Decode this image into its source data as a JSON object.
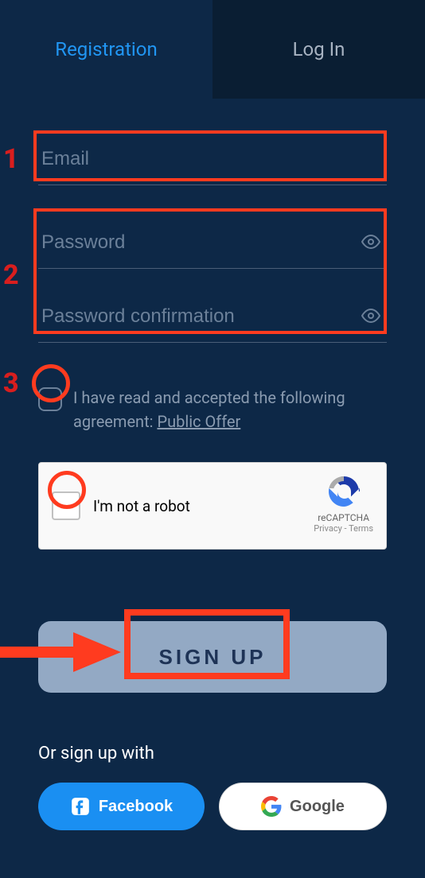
{
  "tabs": {
    "registration": "Registration",
    "login": "Log In"
  },
  "fields": {
    "email_placeholder": "Email",
    "password_placeholder": "Password",
    "password_confirm_placeholder": "Password confirmation"
  },
  "agreement": {
    "text_prefix": "I have read and accepted the following agreement: ",
    "link_text": "Public Offer"
  },
  "captcha": {
    "label": "I'm not a robot",
    "brand": "reCAPTCHA",
    "sublabel": "Privacy - Terms"
  },
  "actions": {
    "signup": "SIGN UP"
  },
  "or_text": "Or sign up with",
  "social": {
    "facebook": "Facebook",
    "google": "Google"
  },
  "annotations": {
    "step1": "1",
    "step2": "2",
    "step3": "3"
  }
}
